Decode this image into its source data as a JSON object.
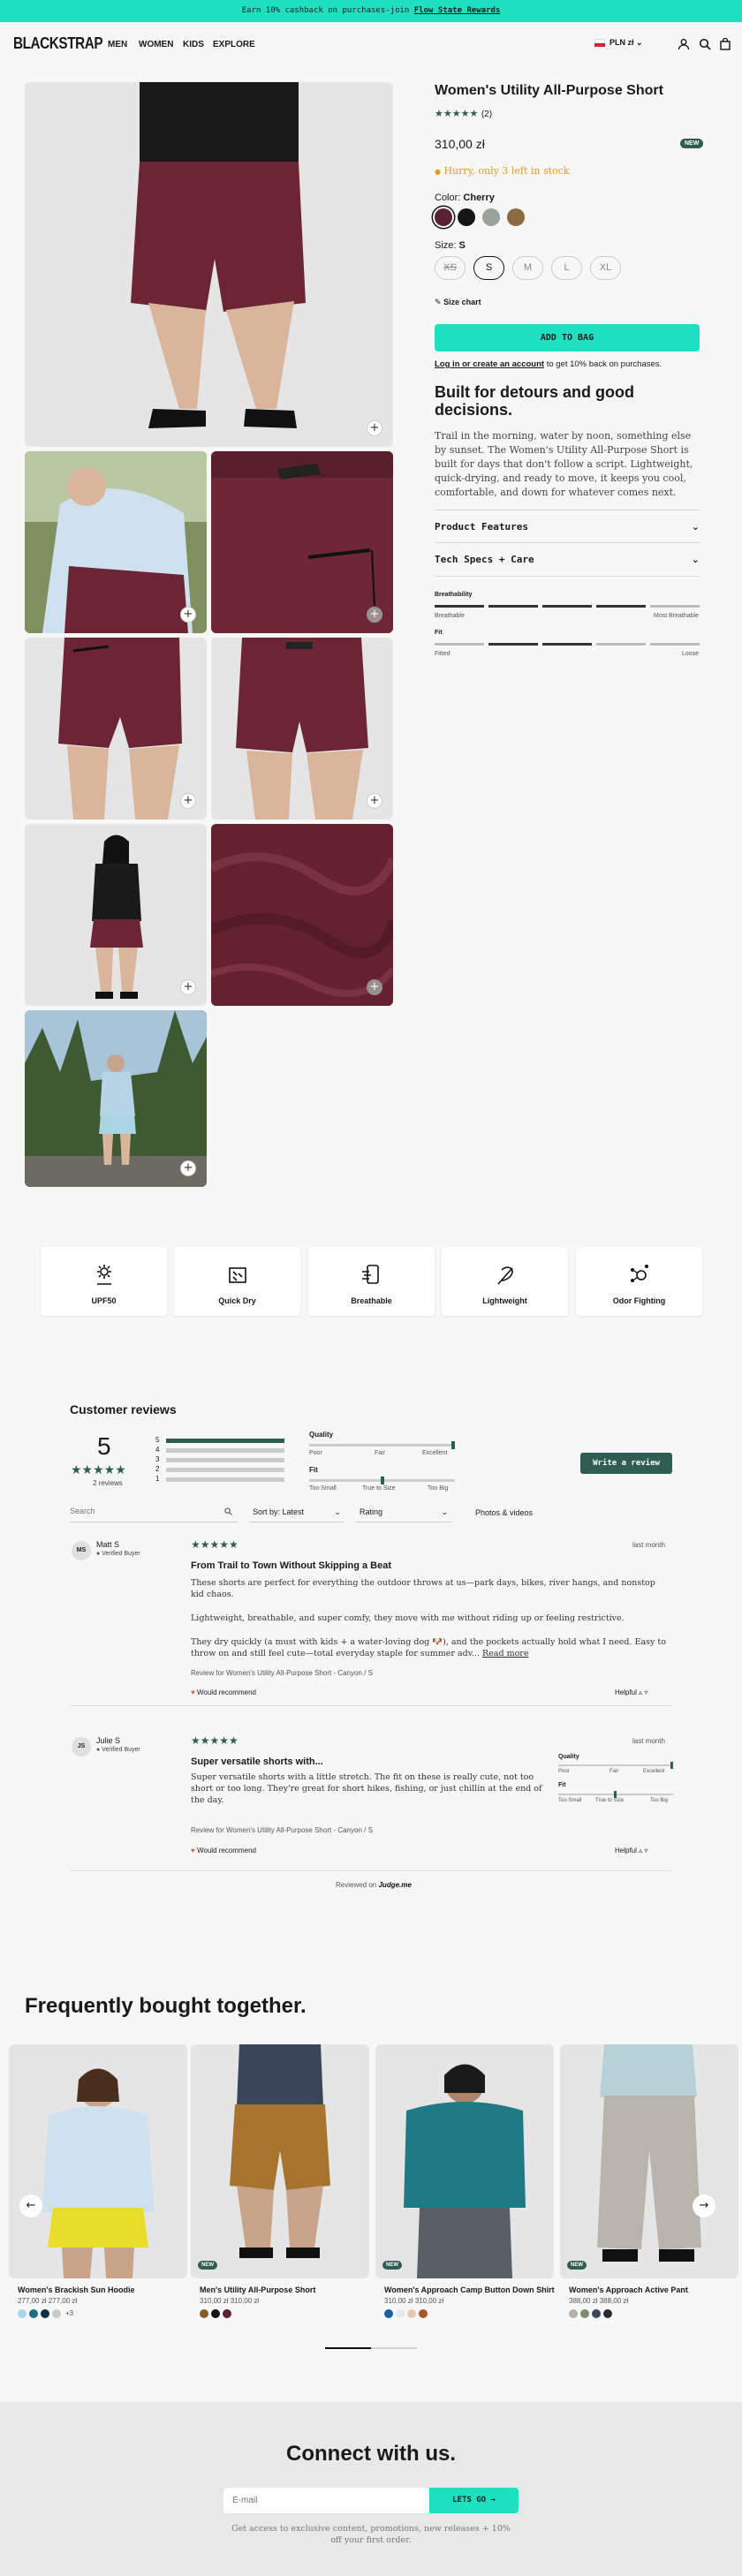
{
  "promo": {
    "text": "Earn 10% cashback on purchases-join",
    "link": "Flow State Rewards"
  },
  "header": {
    "logo": "BLACKSTRAP",
    "nav": [
      "MEN",
      "WOMEN",
      "KIDS",
      "EXPLORE"
    ],
    "currency": "PLN zł"
  },
  "product": {
    "title": "Women's Utility All-Purpose Short",
    "rating_count": "(2)",
    "price": "310,00 zł",
    "badge": "NEW",
    "stock": "Hurry, only 3 left in stock",
    "color_label": "Color:",
    "color_value": "Cherry",
    "swatches": [
      "#5a2130",
      "#151515",
      "#9aa39b",
      "#8b6a3e"
    ],
    "size_label": "Size:",
    "size_value": "S",
    "sizes": [
      "XS",
      "S",
      "M",
      "L",
      "XL"
    ],
    "size_chart": "Size chart",
    "add_to_bag": "ADD TO BAG",
    "login_link": "Log in or create an account",
    "login_rest": "to get 10% back on purchases.",
    "headline": "Built for detours and good decisions.",
    "description": "Trail in the morning, water by noon, something else by sunset. The Women's Utility All-Purpose Short is built for days that don't follow a script. Lightweight, quick-drying, and ready to move, it keeps you cool, comfortable, and down for whatever comes next.",
    "accordions": [
      "Product Features",
      "Tech Specs + Care"
    ],
    "breathability": {
      "label": "Breathability",
      "min": "Breathable",
      "max": "Most Breathable"
    },
    "fit": {
      "label": "Fit",
      "min": "Fitted",
      "max": "Loose"
    }
  },
  "features": [
    "UPF50",
    "Quick Dry",
    "Breathable",
    "Lightweight",
    "Odor Fighting"
  ],
  "reviews": {
    "title": "Customer reviews",
    "avg": "5",
    "count": "2 reviews",
    "dist_labels": [
      "5",
      "4",
      "3",
      "2",
      "1"
    ],
    "dist": [
      1,
      0,
      0,
      0,
      0
    ],
    "quality": {
      "label": "Quality",
      "a": "Poor",
      "b": "Fair",
      "c": "Excellent",
      "level": 1.0
    },
    "fit": {
      "label": "Fit",
      "a": "Too Small",
      "b": "True to Size",
      "c": "Too Big",
      "level": 0.5
    },
    "write": "Write a review",
    "search_placeholder": "Search",
    "sort": "Sort by: Latest",
    "rating": "Rating",
    "photos": "Photos & videos",
    "items": [
      {
        "initials": "MS",
        "name": "Matt S",
        "verified": "Verified Buyer",
        "date": "last month",
        "title": "From Trail to Town Without Skipping a Beat",
        "p1": "These shorts are perfect for everything the outdoor throws at us—park days, bikes, river hangs, and nonstop kid chaos.",
        "p2": "Lightweight, breathable, and super comfy, they move with me without riding up or feeling restrictive.",
        "p3": "They dry quickly (a must with kids + a water-loving dog 🐶), and the pockets actually hold what I need. Easy to throw on and still feel cute—total everyday staple for summer adv...",
        "more": "Read more",
        "product": "Review for Women's Utility All-Purpose Short - Canyon / S",
        "recommend": "Would recommend",
        "helpful": "Helpful"
      },
      {
        "initials": "JS",
        "name": "Julie S",
        "verified": "Verified Buyer",
        "date": "last month",
        "title": "Super versatile shorts with...",
        "p1": "Super versatile shorts with a little stretch. The fit on these is really cute, not too short or too long. They're great for short hikes, fishing, or just chillin at the end of the day.",
        "product": "Review for Women's Utility All-Purpose Short - Canyon / S",
        "recommend": "Would recommend",
        "helpful": "Helpful"
      }
    ],
    "powered": "Reviewed on",
    "powered_brand": "Judge.me"
  },
  "fbt": {
    "title": "Frequently bought together.",
    "items": [
      {
        "name": "Women's Brackish Sun Hoodie",
        "price": "277,00 zł 277,00 zł",
        "colors": [
          "#a8d8e8",
          "#1f6e86",
          "#0f2f44",
          "#c9c9c9"
        ],
        "more": "+3",
        "badge": ""
      },
      {
        "name": "Men's Utility All-Purpose Short",
        "price": "310,00 zł 310,00 zł",
        "colors": [
          "#8b5a2b",
          "#151515",
          "#5a2130"
        ],
        "more": "",
        "badge": "NEW"
      },
      {
        "name": "Women's Approach Camp Button Down Shirt",
        "price": "310,00 zł 310,00 zł",
        "colors": [
          "#1e5fa0",
          "#e8e8e8",
          "#e8c9b0",
          "#a65a2a"
        ],
        "more": "",
        "badge": "NEW"
      },
      {
        "name": "Women's Approach Active Pant",
        "price": "388,00 zł 388,00 zł",
        "colors": [
          "#b7b2a8",
          "#7b8a6a",
          "#3a4a5a",
          "#2a2a2a"
        ],
        "more": "",
        "badge": "NEW"
      }
    ]
  },
  "newsletter": {
    "title": "Connect with us.",
    "placeholder": "E-mail",
    "button": "LETS GO →",
    "note": "Get access to exclusive content, promotions, new releases + 10% off your first order."
  }
}
